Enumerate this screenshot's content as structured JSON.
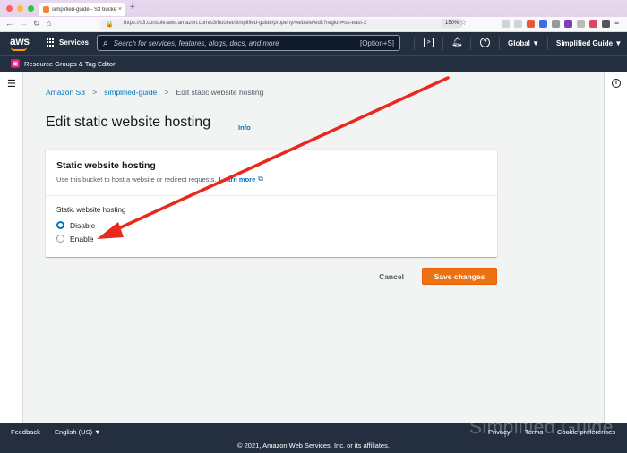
{
  "browser": {
    "tab_title": "simplified-guide - S3 bucket",
    "tab_close": "×",
    "new_tab": "+",
    "url": "https://s3.console.aws.amazon.com/s3/bucket/simplified-guide/property/website/edit?region=us-east-2",
    "zoom": "150%"
  },
  "aws_header": {
    "logo": "aws",
    "services_label": "Services",
    "search_placeholder": "Search for services, features, blogs, docs, and more",
    "search_shortcut": "[Option+S]",
    "region_menu": "Global ▼",
    "account_menu": "Simplified Guide ▼",
    "icons": [
      "cloudshell-icon",
      "bell-icon",
      "help-icon"
    ]
  },
  "subnav": {
    "resource_groups": "Resource Groups & Tag Editor"
  },
  "breadcrumb": {
    "items": [
      "Amazon S3",
      "simplified-guide",
      "Edit static website hosting"
    ]
  },
  "page": {
    "title": "Edit static website hosting",
    "info_link": "Info"
  },
  "panel": {
    "title": "Static website hosting",
    "description": "Use this bucket to host a website or redirect requests.",
    "learn_more": "Learn more",
    "field_label": "Static website hosting",
    "options": [
      {
        "label": "Disable",
        "selected": true
      },
      {
        "label": "Enable",
        "selected": false
      }
    ]
  },
  "actions": {
    "cancel": "Cancel",
    "save": "Save changes"
  },
  "footer": {
    "feedback": "Feedback",
    "language": "English (US) ▼",
    "copyright": "© 2021, Amazon Web Services, Inc. or its affiliates.",
    "privacy": "Privacy",
    "terms": "Terms",
    "cookie": "Cookie preferences",
    "watermark": "Simplified Guide"
  },
  "colors": {
    "aws_nav": "#232f3e",
    "link": "#0073bb",
    "primary_button": "#ec7211",
    "annotation_arrow": "#e8291c"
  }
}
